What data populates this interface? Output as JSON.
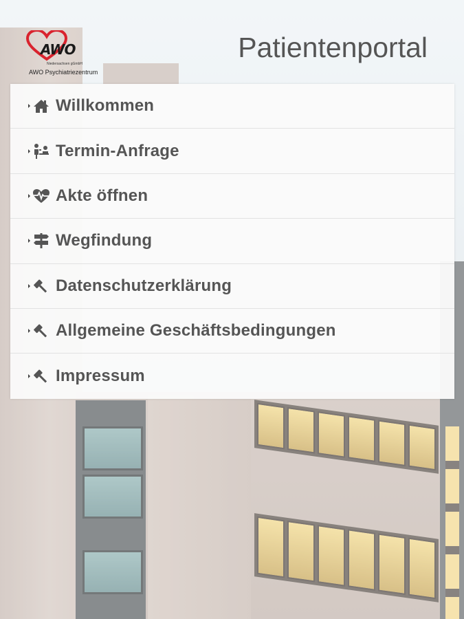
{
  "header": {
    "logo": {
      "wordmark": "AWO",
      "subline_small": "Niedersachsen gGmbH",
      "subline": "AWO Psychiatriezentrum"
    },
    "title": "Patientenportal"
  },
  "menu": {
    "items": [
      {
        "label": "Willkommen",
        "icon": "home-icon"
      },
      {
        "label": "Termin-Anfrage",
        "icon": "consultation-icon"
      },
      {
        "label": "Akte öffnen",
        "icon": "heartbeat-icon"
      },
      {
        "label": "Wegfindung",
        "icon": "signpost-icon"
      },
      {
        "label": "Datenschutzerklärung",
        "icon": "gavel-icon"
      },
      {
        "label": "Allgemeine Geschäftsbedingungen",
        "icon": "gavel-icon"
      },
      {
        "label": "Impressum",
        "icon": "gavel-icon"
      }
    ]
  },
  "colors": {
    "logo_heart": "#d9232e",
    "menu_text": "#555555",
    "title_text": "#555555",
    "menu_background": "#fafafa"
  }
}
